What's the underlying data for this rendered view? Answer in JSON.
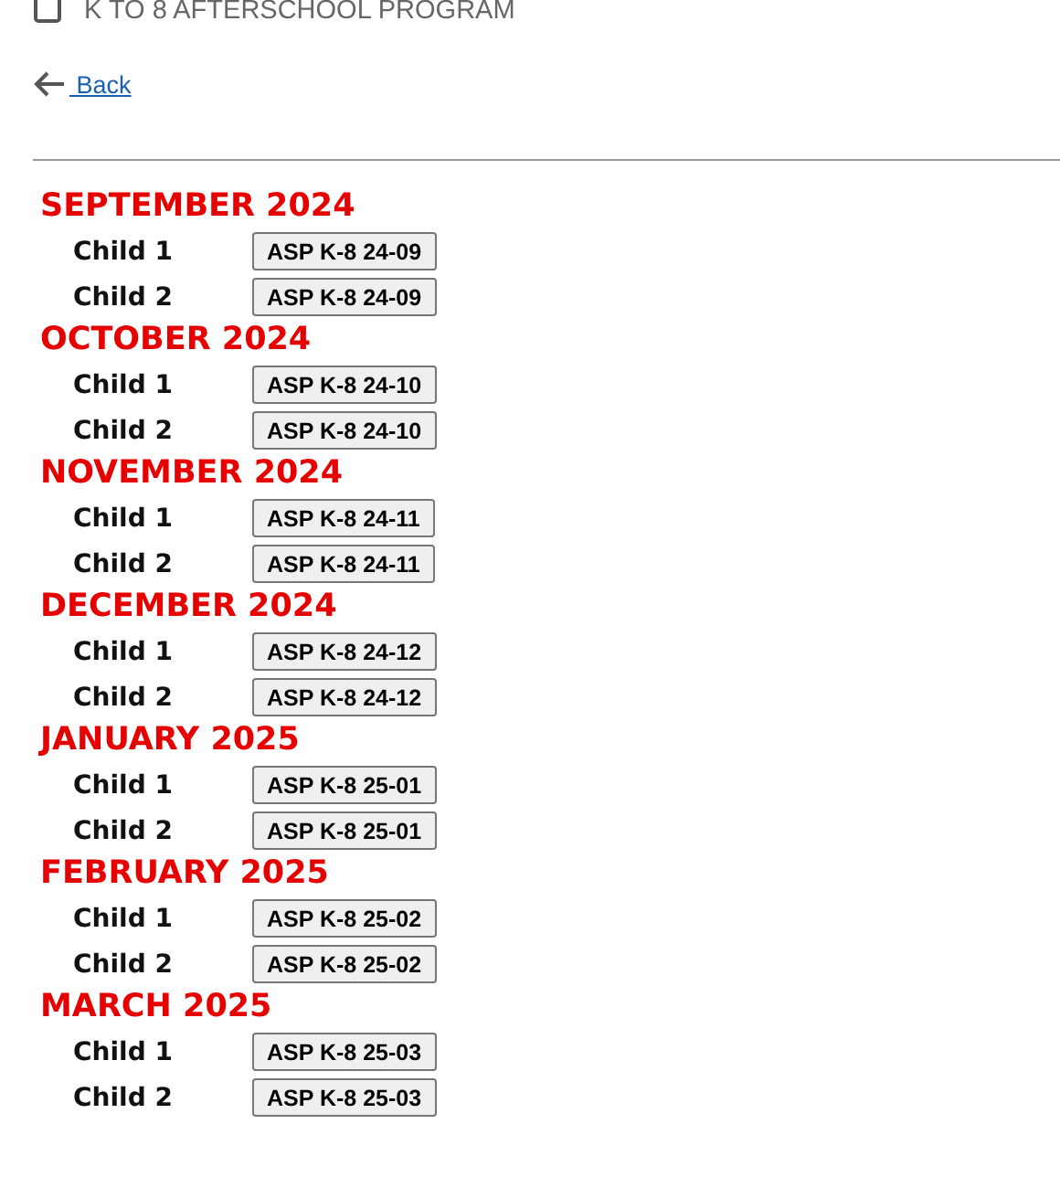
{
  "header": {
    "title": "K TO 8 AFTERSCHOOL PROGRAM"
  },
  "back_link": {
    "label": "Back"
  },
  "months": [
    {
      "heading": "SEPTEMBER 2024",
      "rows": [
        {
          "child": "Child 1",
          "button": "ASP K-8 24-09"
        },
        {
          "child": "Child 2",
          "button": "ASP K-8 24-09"
        }
      ]
    },
    {
      "heading": "OCTOBER 2024",
      "rows": [
        {
          "child": "Child 1",
          "button": "ASP K-8 24-10"
        },
        {
          "child": "Child 2",
          "button": "ASP K-8 24-10"
        }
      ]
    },
    {
      "heading": "NOVEMBER 2024",
      "rows": [
        {
          "child": "Child 1",
          "button": "ASP K-8 24-11"
        },
        {
          "child": "Child 2",
          "button": "ASP K-8 24-11"
        }
      ]
    },
    {
      "heading": "DECEMBER 2024",
      "rows": [
        {
          "child": "Child 1",
          "button": "ASP K-8 24-12"
        },
        {
          "child": "Child 2",
          "button": "ASP K-8 24-12"
        }
      ]
    },
    {
      "heading": "JANUARY 2025",
      "rows": [
        {
          "child": "Child 1",
          "button": "ASP K-8 25-01"
        },
        {
          "child": "Child 2",
          "button": "ASP K-8 25-01"
        }
      ]
    },
    {
      "heading": "FEBRUARY 2025",
      "rows": [
        {
          "child": "Child 1",
          "button": "ASP K-8 25-02"
        },
        {
          "child": "Child 2",
          "button": "ASP K-8 25-02"
        }
      ]
    },
    {
      "heading": "MARCH 2025",
      "rows": [
        {
          "child": "Child 1",
          "button": "ASP K-8 25-03"
        },
        {
          "child": "Child 2",
          "button": "ASP K-8 25-03"
        }
      ]
    }
  ]
}
